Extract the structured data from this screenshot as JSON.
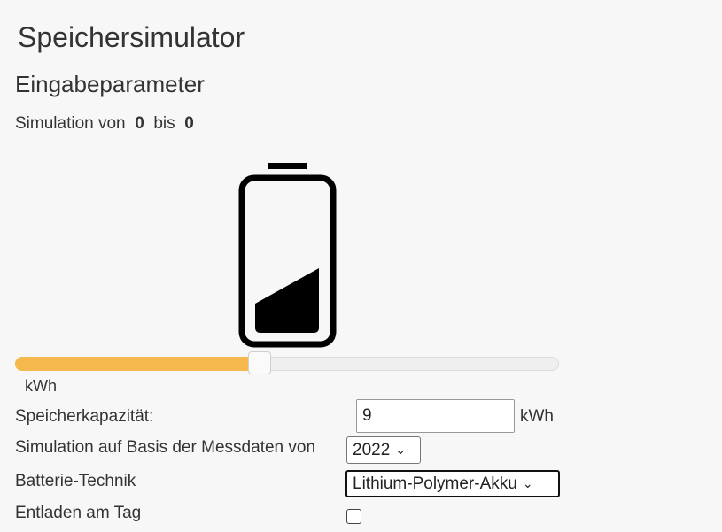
{
  "app": {
    "title": "Speichersimulator",
    "section_title": "Eingabeparameter"
  },
  "simulation_range": {
    "prefix": "Simulation von",
    "from": "0",
    "middle": "bis",
    "to": "0"
  },
  "battery": {
    "icon": "battery-icon",
    "charge_level": 0.45
  },
  "slider": {
    "value_fraction": 0.45,
    "unit": "kWh",
    "fill_color": "#f5b84c"
  },
  "form": {
    "capacity": {
      "label": "Speicherkapazität:",
      "value": "9",
      "unit": "kWh"
    },
    "data_year": {
      "label": "Simulation auf Basis der Messdaten von",
      "selected": "2022"
    },
    "technology": {
      "label": "Batterie-Technik",
      "selected": "Lithium-Polymer-Akku"
    },
    "discharge_day": {
      "label": "Entladen am Tag",
      "checked": false
    }
  }
}
